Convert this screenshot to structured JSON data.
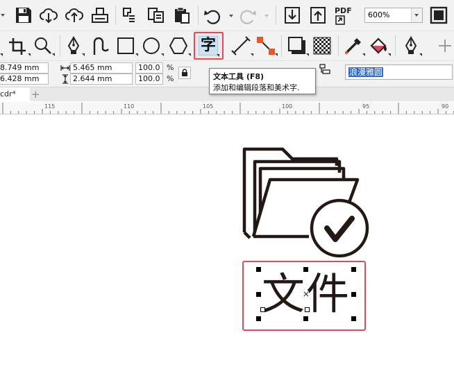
{
  "toolbar_top": {
    "icons": [
      "save-icon",
      "cloud-download-icon",
      "cloud-upload-icon",
      "print-icon",
      "import-snap-icon",
      "copy-icon",
      "paste-icon",
      "undo-icon",
      "redo-icon",
      "import-icon",
      "export-icon",
      "export-pdf-icon",
      "full-screen-icon"
    ],
    "pdf_label": "PDF",
    "zoom_value": "600%"
  },
  "toolbox": {
    "icons": [
      "pick-arrow-icon",
      "crop-icon",
      "zoom-icon",
      "pen-icon",
      "curve-icon",
      "rectangle-icon",
      "ellipse-icon",
      "polygon-icon",
      "text-tool-icon",
      "dimension-icon",
      "connector-icon",
      "drop-shadow-icon",
      "transparency-icon",
      "eyedropper-icon",
      "interactive-fill-icon",
      "outline-pen-icon",
      "add-icon"
    ],
    "text_tool_glyph": "字",
    "active_tool": "text-tool",
    "highlight_color": "#e04a5b"
  },
  "property_bar": {
    "x_value": "8.749 mm",
    "y_value": "6.428 mm",
    "width_value": "5.465 mm",
    "height_value": "2.644 mm",
    "scale_x": "100.0",
    "scale_y": "100.0",
    "percent_x": "%",
    "percent_y": "%",
    "font_name": "浪漫雅圆"
  },
  "tooltip": {
    "title": "文本工具 (F8)",
    "description": "添加和编辑段落和美术字."
  },
  "document_tab": {
    "label": "cdr*",
    "add_label": "+"
  },
  "ruler": {
    "labels": [
      "115",
      "110",
      "105",
      "100",
      "95",
      "90"
    ]
  },
  "canvas": {
    "artwork_icon": "folder-check-icon",
    "text_object": "文件",
    "selection_color": "#e04a5b"
  }
}
